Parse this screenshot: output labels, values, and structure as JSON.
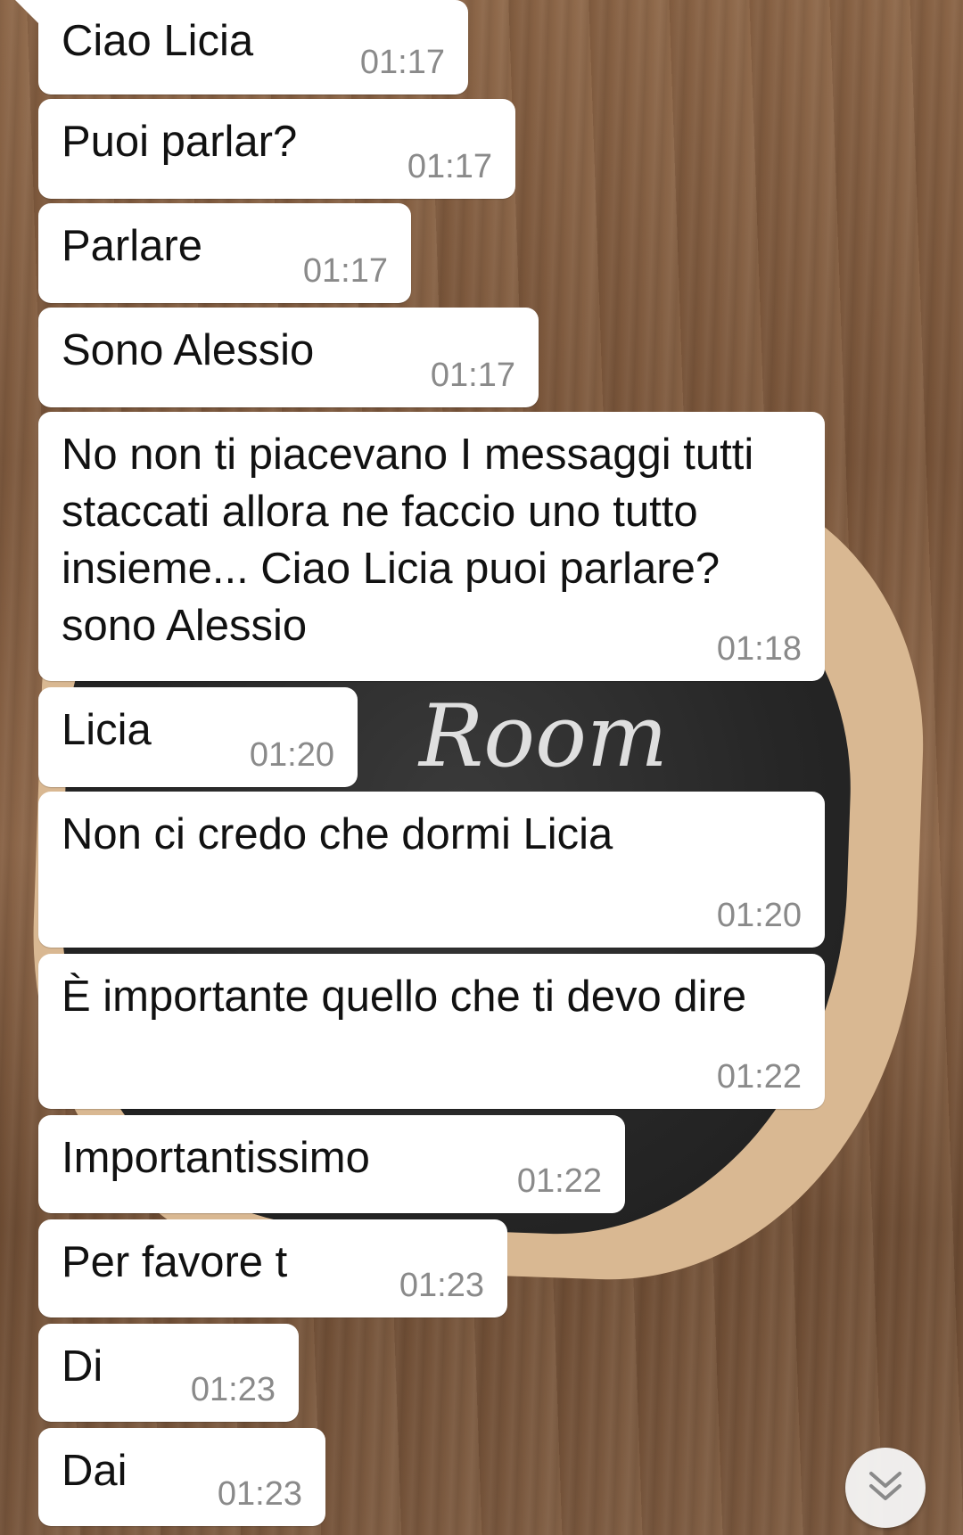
{
  "background": {
    "sign_text": "Room"
  },
  "messages": [
    {
      "text": "Ciao Licia",
      "time": "01:17"
    },
    {
      "text": "Puoi parlar?",
      "time": "01:17"
    },
    {
      "text": "Parlare",
      "time": "01:17"
    },
    {
      "text": "Sono Alessio",
      "time": "01:17"
    },
    {
      "text": "No non ti piacevano I messaggi tutti staccati allora ne faccio uno tutto insieme... Ciao Licia puoi parlare? sono Alessio",
      "time": "01:18"
    },
    {
      "text": "Licia",
      "time": "01:20"
    },
    {
      "text": "Non ci credo che dormi Licia",
      "time": "01:20"
    },
    {
      "text": "È importante quello che ti devo dire",
      "time": "01:22"
    },
    {
      "text": "Importantissimo",
      "time": "01:22"
    },
    {
      "text": "Per favore t",
      "time": "01:23"
    },
    {
      "text": "Di",
      "time": "01:23"
    },
    {
      "text": "Dai",
      "time": "01:23"
    }
  ],
  "scroll_button": {
    "icon": "double-chevron-down-icon"
  },
  "colors": {
    "bubble_bg": "#ffffff",
    "message_text": "#111111",
    "timestamp_text": "#8a8a8a"
  }
}
